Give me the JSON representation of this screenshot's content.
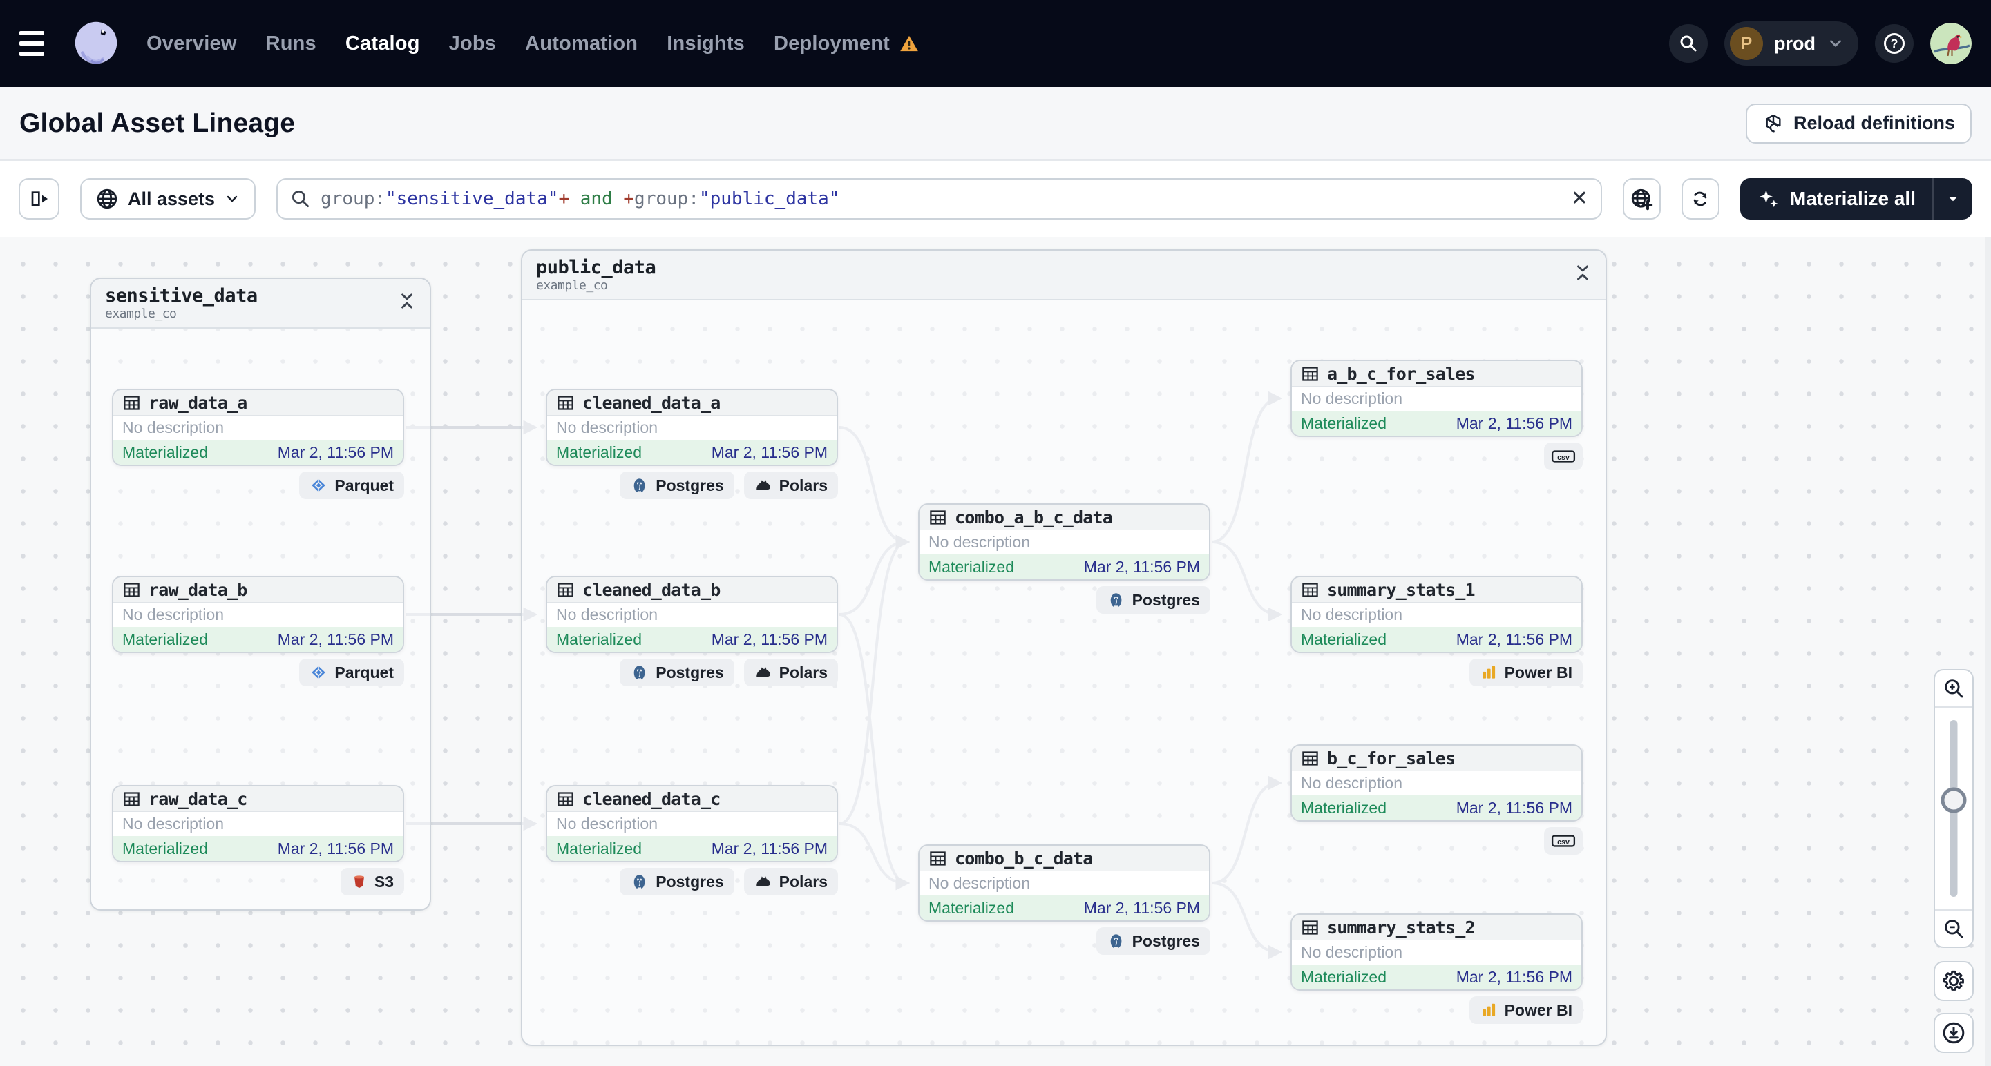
{
  "nav": {
    "items": [
      {
        "label": "Overview",
        "active": false,
        "warning": false
      },
      {
        "label": "Runs",
        "active": false,
        "warning": false
      },
      {
        "label": "Catalog",
        "active": true,
        "warning": false
      },
      {
        "label": "Jobs",
        "active": false,
        "warning": false
      },
      {
        "label": "Automation",
        "active": false,
        "warning": false
      },
      {
        "label": "Insights",
        "active": false,
        "warning": false
      },
      {
        "label": "Deployment",
        "active": false,
        "warning": true
      }
    ],
    "environment": {
      "initial": "P",
      "name": "prod"
    }
  },
  "header": {
    "title": "Global Asset Lineage",
    "reload_button": "Reload definitions"
  },
  "toolbar": {
    "assets_filter_label": "All assets",
    "materialize_label": "Materialize all",
    "search": {
      "tokens": [
        {
          "text": "group:",
          "color": "#6a7280"
        },
        {
          "text": "\"sensitive_data\"",
          "color": "#2d34a1"
        },
        {
          "text": "+",
          "color": "#a03a2c"
        },
        {
          "text": " and ",
          "color": "#2e7d46"
        },
        {
          "text": "+",
          "color": "#a03a2c"
        },
        {
          "text": "group:",
          "color": "#6a7280"
        },
        {
          "text": "\"public_data\"",
          "color": "#2d34a1"
        }
      ]
    }
  },
  "graph": {
    "groups": [
      {
        "id": "sensitive_data",
        "name": "sensitive_data",
        "repo": "example_co"
      },
      {
        "id": "public_data",
        "name": "public_data",
        "repo": "example_co"
      }
    ],
    "nodes": [
      {
        "id": "raw_data_a",
        "group": "sensitive_data",
        "name": "raw_data_a",
        "description": "No description",
        "status": "Materialized",
        "timestamp": "Mar 2, 11:56 PM",
        "badges": [
          {
            "icon": "parquet-icon",
            "label": "Parquet"
          }
        ]
      },
      {
        "id": "raw_data_b",
        "group": "sensitive_data",
        "name": "raw_data_b",
        "description": "No description",
        "status": "Materialized",
        "timestamp": "Mar 2, 11:56 PM",
        "badges": [
          {
            "icon": "parquet-icon",
            "label": "Parquet"
          }
        ]
      },
      {
        "id": "raw_data_c",
        "group": "sensitive_data",
        "name": "raw_data_c",
        "description": "No description",
        "status": "Materialized",
        "timestamp": "Mar 2, 11:56 PM",
        "badges": [
          {
            "icon": "s3-icon",
            "label": "S3"
          }
        ]
      },
      {
        "id": "cleaned_data_a",
        "group": "public_data",
        "name": "cleaned_data_a",
        "description": "No description",
        "status": "Materialized",
        "timestamp": "Mar 2, 11:56 PM",
        "badges": [
          {
            "icon": "postgres-icon",
            "label": "Postgres"
          },
          {
            "icon": "polars-icon",
            "label": "Polars"
          }
        ]
      },
      {
        "id": "cleaned_data_b",
        "group": "public_data",
        "name": "cleaned_data_b",
        "description": "No description",
        "status": "Materialized",
        "timestamp": "Mar 2, 11:56 PM",
        "badges": [
          {
            "icon": "postgres-icon",
            "label": "Postgres"
          },
          {
            "icon": "polars-icon",
            "label": "Polars"
          }
        ]
      },
      {
        "id": "cleaned_data_c",
        "group": "public_data",
        "name": "cleaned_data_c",
        "description": "No description",
        "status": "Materialized",
        "timestamp": "Mar 2, 11:56 PM",
        "badges": [
          {
            "icon": "postgres-icon",
            "label": "Postgres"
          },
          {
            "icon": "polars-icon",
            "label": "Polars"
          }
        ]
      },
      {
        "id": "combo_a_b_c_data",
        "group": "public_data",
        "name": "combo_a_b_c_data",
        "description": "No description",
        "status": "Materialized",
        "timestamp": "Mar 2, 11:56 PM",
        "badges": [
          {
            "icon": "postgres-icon",
            "label": "Postgres"
          }
        ]
      },
      {
        "id": "a_b_c_for_sales",
        "group": "public_data",
        "name": "a_b_c_for_sales",
        "description": "No description",
        "status": "Materialized",
        "timestamp": "Mar 2, 11:56 PM",
        "badges": [
          {
            "icon": "csv-icon",
            "label": ""
          }
        ]
      },
      {
        "id": "summary_stats_1",
        "group": "public_data",
        "name": "summary_stats_1",
        "description": "No description",
        "status": "Materialized",
        "timestamp": "Mar 2, 11:56 PM",
        "badges": [
          {
            "icon": "powerbi-icon",
            "label": "Power BI"
          }
        ]
      },
      {
        "id": "b_c_for_sales",
        "group": "public_data",
        "name": "b_c_for_sales",
        "description": "No description",
        "status": "Materialized",
        "timestamp": "Mar 2, 11:56 PM",
        "badges": [
          {
            "icon": "csv-icon",
            "label": ""
          }
        ]
      },
      {
        "id": "combo_b_c_data",
        "group": "public_data",
        "name": "combo_b_c_data",
        "description": "No description",
        "status": "Materialized",
        "timestamp": "Mar 2, 11:56 PM",
        "badges": [
          {
            "icon": "postgres-icon",
            "label": "Postgres"
          }
        ]
      },
      {
        "id": "summary_stats_2",
        "group": "public_data",
        "name": "summary_stats_2",
        "description": "No description",
        "status": "Materialized",
        "timestamp": "Mar 2, 11:56 PM",
        "badges": [
          {
            "icon": "powerbi-icon",
            "label": "Power BI"
          }
        ]
      }
    ],
    "edges": [
      {
        "from": "raw_data_a",
        "to": "cleaned_data_a"
      },
      {
        "from": "raw_data_b",
        "to": "cleaned_data_b"
      },
      {
        "from": "raw_data_c",
        "to": "cleaned_data_c"
      },
      {
        "from": "cleaned_data_a",
        "to": "combo_a_b_c_data"
      },
      {
        "from": "cleaned_data_b",
        "to": "combo_a_b_c_data"
      },
      {
        "from": "cleaned_data_c",
        "to": "combo_a_b_c_data"
      },
      {
        "from": "cleaned_data_b",
        "to": "combo_b_c_data"
      },
      {
        "from": "cleaned_data_c",
        "to": "combo_b_c_data"
      },
      {
        "from": "combo_a_b_c_data",
        "to": "a_b_c_for_sales"
      },
      {
        "from": "combo_a_b_c_data",
        "to": "summary_stats_1"
      },
      {
        "from": "combo_b_c_data",
        "to": "b_c_for_sales"
      },
      {
        "from": "combo_b_c_data",
        "to": "summary_stats_2"
      }
    ]
  },
  "colors": {
    "accent_green": "#1d8a59",
    "footer_green_bg": "#e6f4ea",
    "timestamp_navy": "#282e8c",
    "edge_gray": "#d9dce2",
    "warning_orange": "#efa33d",
    "navbar_bg": "#060a18"
  }
}
